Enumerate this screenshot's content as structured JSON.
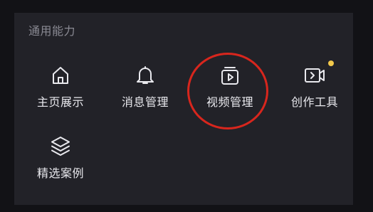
{
  "section": {
    "title": "通用能力"
  },
  "tools": [
    {
      "label": "主页展示",
      "icon": "home-icon"
    },
    {
      "label": "消息管理",
      "icon": "bell-icon"
    },
    {
      "label": "视频管理",
      "icon": "video-library-icon"
    },
    {
      "label": "创作工具",
      "icon": "video-camera-icon",
      "badge_color": "#f2c84b"
    },
    {
      "label": "精选案例",
      "icon": "layers-icon"
    }
  ],
  "colors": {
    "page_background": "#121216",
    "panel_background": "#222228",
    "title_text": "#8a8a93",
    "label_text": "#e9e9ee",
    "icon_stroke": "#e9e9ee",
    "notification_dot": "#f2c84b",
    "highlight_ring": "#d8261d"
  }
}
